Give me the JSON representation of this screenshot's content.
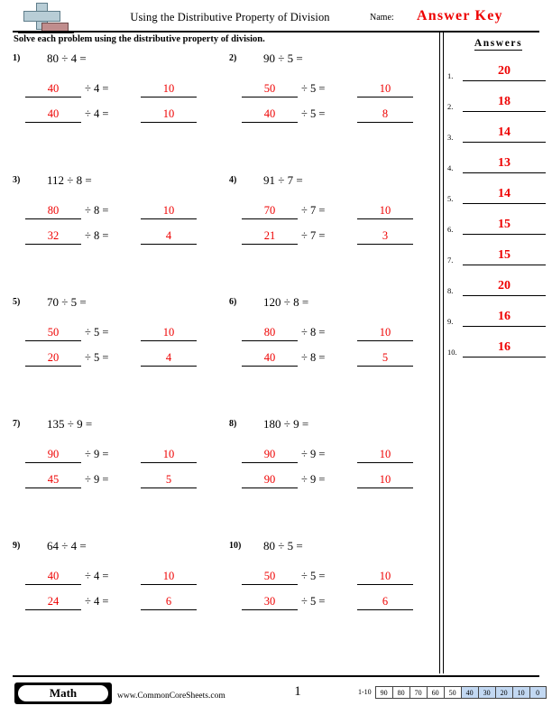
{
  "header": {
    "title": "Using the Distributive Property of Division",
    "name_label": "Name:",
    "answer_key": "Answer Key",
    "logo_icon": "math-cross-book-logo"
  },
  "instructions": "Solve each problem using the distributive property of division.",
  "problems": [
    {
      "number": "1)",
      "expression": "80 ÷ 4 =",
      "lines": [
        {
          "part": "40",
          "divisor": "÷ 4 =",
          "result": "10"
        },
        {
          "part": "40",
          "divisor": "÷ 4 =",
          "result": "10"
        }
      ]
    },
    {
      "number": "2)",
      "expression": "90 ÷ 5 =",
      "lines": [
        {
          "part": "50",
          "divisor": "÷ 5 =",
          "result": "10"
        },
        {
          "part": "40",
          "divisor": "÷ 5 =",
          "result": "8"
        }
      ]
    },
    {
      "number": "3)",
      "expression": "112 ÷ 8 =",
      "lines": [
        {
          "part": "80",
          "divisor": "÷ 8 =",
          "result": "10"
        },
        {
          "part": "32",
          "divisor": "÷ 8 =",
          "result": "4"
        }
      ]
    },
    {
      "number": "4)",
      "expression": "91 ÷ 7 =",
      "lines": [
        {
          "part": "70",
          "divisor": "÷ 7 =",
          "result": "10"
        },
        {
          "part": "21",
          "divisor": "÷ 7 =",
          "result": "3"
        }
      ]
    },
    {
      "number": "5)",
      "expression": "70 ÷ 5 =",
      "lines": [
        {
          "part": "50",
          "divisor": "÷ 5 =",
          "result": "10"
        },
        {
          "part": "20",
          "divisor": "÷ 5 =",
          "result": "4"
        }
      ]
    },
    {
      "number": "6)",
      "expression": "120 ÷ 8 =",
      "lines": [
        {
          "part": "80",
          "divisor": "÷ 8 =",
          "result": "10"
        },
        {
          "part": "40",
          "divisor": "÷ 8 =",
          "result": "5"
        }
      ]
    },
    {
      "number": "7)",
      "expression": "135 ÷ 9 =",
      "lines": [
        {
          "part": "90",
          "divisor": "÷ 9 =",
          "result": "10"
        },
        {
          "part": "45",
          "divisor": "÷ 9 =",
          "result": "5"
        }
      ]
    },
    {
      "number": "8)",
      "expression": "180 ÷ 9 =",
      "lines": [
        {
          "part": "90",
          "divisor": "÷ 9 =",
          "result": "10"
        },
        {
          "part": "90",
          "divisor": "÷ 9 =",
          "result": "10"
        }
      ]
    },
    {
      "number": "9)",
      "expression": "64 ÷ 4 =",
      "lines": [
        {
          "part": "40",
          "divisor": "÷ 4 =",
          "result": "10"
        },
        {
          "part": "24",
          "divisor": "÷ 4 =",
          "result": "6"
        }
      ]
    },
    {
      "number": "10)",
      "expression": "80 ÷ 5 =",
      "lines": [
        {
          "part": "50",
          "divisor": "÷ 5 =",
          "result": "10"
        },
        {
          "part": "30",
          "divisor": "÷ 5 =",
          "result": "6"
        }
      ]
    }
  ],
  "answers_panel": {
    "heading": "Answers",
    "rows": [
      {
        "number": "1.",
        "value": "20"
      },
      {
        "number": "2.",
        "value": "18"
      },
      {
        "number": "3.",
        "value": "14"
      },
      {
        "number": "4.",
        "value": "13"
      },
      {
        "number": "5.",
        "value": "14"
      },
      {
        "number": "6.",
        "value": "15"
      },
      {
        "number": "7.",
        "value": "15"
      },
      {
        "number": "8.",
        "value": "20"
      },
      {
        "number": "9.",
        "value": "16"
      },
      {
        "number": "10.",
        "value": "16"
      }
    ]
  },
  "footer": {
    "subject_badge": "Math",
    "website": "www.CommonCoreSheets.com",
    "page_number": "1",
    "scale_label": "1-10",
    "scale_boxes": [
      {
        "value": "90",
        "highlighted": false
      },
      {
        "value": "80",
        "highlighted": false
      },
      {
        "value": "70",
        "highlighted": false
      },
      {
        "value": "60",
        "highlighted": false
      },
      {
        "value": "50",
        "highlighted": false
      },
      {
        "value": "40",
        "highlighted": true
      },
      {
        "value": "30",
        "highlighted": true
      },
      {
        "value": "20",
        "highlighted": true
      },
      {
        "value": "10",
        "highlighted": true
      },
      {
        "value": "0",
        "highlighted": true
      }
    ]
  },
  "colors": {
    "answer_red": "#ee0000",
    "highlight_blue": "#c2d8f2",
    "logo_blue": "#b8cdd6",
    "logo_red": "#c08d8d"
  }
}
